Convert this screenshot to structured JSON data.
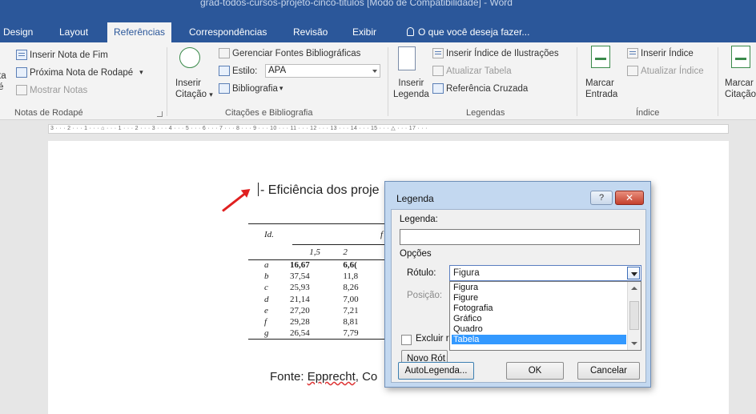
{
  "window": {
    "title": "grad-todos-cursos-projeto-cinco-titulos [Modo de Compatibilidade] - Word"
  },
  "tabs": [
    {
      "label": "Design"
    },
    {
      "label": "Layout"
    },
    {
      "label": "Referências"
    },
    {
      "label": "Correspondências"
    },
    {
      "label": "Revisão"
    },
    {
      "label": "Exibir"
    }
  ],
  "tellme": "O que você deseja fazer...",
  "ribbon": {
    "notas": {
      "inserir_nota_fim": "Inserir Nota de Fim",
      "proxima_nota": "Próxima Nota de Rodapé",
      "mostrar_notas": "Mostrar Notas",
      "clip_left_1": "ta",
      "clip_left_2": "é",
      "group": "Notas de Rodapé"
    },
    "citacoes": {
      "inserir_citacao_1": "Inserir",
      "inserir_citacao_2": "Citação",
      "gerenciar_fontes": "Gerenciar Fontes Bibliográficas",
      "estilo_label": "Estilo:",
      "estilo_value": "APA",
      "bibliografia": "Bibliografia",
      "group": "Citações e Bibliografia"
    },
    "legendas": {
      "inserir_legenda_1": "Inserir",
      "inserir_legenda_2": "Legenda",
      "inserir_indice_ilustracoes": "Inserir Índice de Ilustrações",
      "atualizar_tabela": "Atualizar Tabela",
      "referencia_cruzada": "Referência Cruzada",
      "group": "Legendas"
    },
    "indice": {
      "marcar_entrada_1": "Marcar",
      "marcar_entrada_2": "Entrada",
      "inserir_indice": "Inserir Índice",
      "atualizar_indice": "Atualizar Índice",
      "group": "Índice"
    },
    "autoridades": {
      "marcar_citacao_1": "Marcar",
      "marcar_citacao_2": "Citação"
    }
  },
  "ruler": {
    "text": "3 · · · 2 · · · 1 · · · ⌂ · · · 1 · · · 2 · · · 3 · · · 4 · · · 5 · · · 6 · · · 7 · · · 8 · · · 9 · · · 10 · · · 11 · · · 12 · · · 13 · · · 14 · · · 15 · · · △ · · · 17 · · ·"
  },
  "document": {
    "caption": "- Eficiência dos proje",
    "fonte_prefix": "Fonte: ",
    "fonte_word": "Epprecht",
    "fonte_suffix": ", Co",
    "table": {
      "head_id": "Id.",
      "head_partial": "f",
      "sub": [
        "1,5",
        "2"
      ],
      "rows": [
        {
          "id": "a",
          "v1": "16,67",
          "v2": "6,6("
        },
        {
          "id": "b",
          "v1": "37,54",
          "v2": "11,8"
        },
        {
          "id": "c",
          "v1": "25,93",
          "v2": "8,26"
        },
        {
          "id": "d",
          "v1": "21,14",
          "v2": "7,00"
        },
        {
          "id": "e",
          "v1": "27,20",
          "v2": "7,21"
        },
        {
          "id": "f",
          "v1": "29,28",
          "v2": "8,81"
        },
        {
          "id": "g",
          "v1": "26,54",
          "v2": "7,79"
        }
      ]
    }
  },
  "dialog": {
    "title": "Legenda",
    "help": "?",
    "close": "✕",
    "legenda_label": "Legenda:",
    "legenda_value": "",
    "opcoes": "Opções",
    "rotulo_label": "Rótulo:",
    "rotulo_value": "Figura",
    "posicao_label": "Posição:",
    "options": [
      "Figura",
      "Figure",
      "Fotografia",
      "Gráfico",
      "Quadro",
      "Tabela"
    ],
    "selected": "Tabela",
    "excluir_label": "Excluir r",
    "novo_rotulo": "Novo Rót",
    "autolegenda": "AutoLegenda...",
    "ok": "OK",
    "cancelar": "Cancelar"
  }
}
